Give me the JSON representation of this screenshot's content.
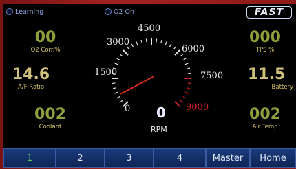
{
  "indicators": {
    "learning_label": "Learning",
    "o2_label": "O2 On"
  },
  "brand": {
    "logo_text": "FAST"
  },
  "readouts": {
    "o2_corr": {
      "value": "00",
      "label": "O2 Corr.%"
    },
    "af_ratio": {
      "value": "14.6",
      "label": "A/F Ratio"
    },
    "coolant": {
      "value": "002",
      "label": "Coolant"
    },
    "tps": {
      "value": "000",
      "label": "TPS %"
    },
    "battery": {
      "value": "11.5",
      "label": "Battery"
    },
    "air_temp": {
      "value": "002",
      "label": "Air Temp"
    }
  },
  "gauge": {
    "ticks": {
      "t0": "0",
      "t1500": "1500",
      "t3000": "3000",
      "t4500": "4500",
      "t6000": "6000",
      "t7500": "7500",
      "t9000": "9000"
    },
    "rpm_value": "0",
    "rpm_label": "RPM",
    "needle_value": 0,
    "max": 9000,
    "redline": 7500
  },
  "tabs": [
    {
      "label": "1",
      "active": true
    },
    {
      "label": "2",
      "active": false
    },
    {
      "label": "3",
      "active": false
    },
    {
      "label": "4",
      "active": false
    },
    {
      "label": "Master",
      "active": false
    },
    {
      "label": "Home",
      "active": false
    }
  ],
  "colors": {
    "bezel": "#8d1a1a",
    "value_olive": "#8f9f3c",
    "value_tan": "#d0c07a",
    "caption_yellow": "#d8c86a",
    "tab_blue": "#1a3b7a",
    "redline": "#d22020",
    "active_tab_text": "#59c85a"
  }
}
